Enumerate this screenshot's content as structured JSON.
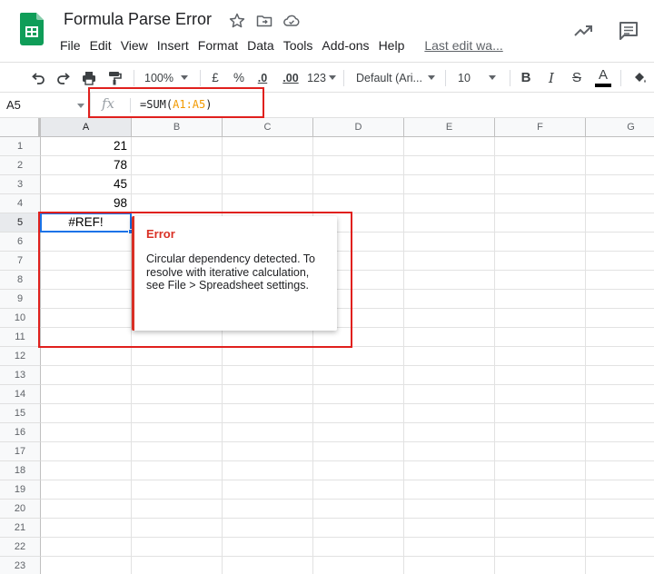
{
  "app": {
    "document_title": "Formula Parse Error",
    "last_edit": "Last edit wa...",
    "brand_color": "#0f9d58"
  },
  "menu": [
    "File",
    "Edit",
    "View",
    "Insert",
    "Format",
    "Data",
    "Tools",
    "Add-ons",
    "Help"
  ],
  "toolbar": {
    "zoom": "100%",
    "currency": "£",
    "percent": "%",
    "decrease_decimal": ".0",
    "increase_decimal": ".00",
    "more_formats": "123",
    "font_family": "Default (Ari...",
    "font_size": "10",
    "bold": "B",
    "italic": "I",
    "strikethrough": "S",
    "text_color": "A"
  },
  "formula_bar": {
    "cell_reference": "A5",
    "fx_label": "fx",
    "formula_prefix": "=SUM(",
    "formula_range": "A1:A5",
    "formula_suffix": ")"
  },
  "sheet": {
    "columns": [
      "A",
      "B",
      "C",
      "D",
      "E",
      "F",
      "G"
    ],
    "rows": [
      "1",
      "2",
      "3",
      "4",
      "5",
      "6",
      "7",
      "8",
      "9",
      "10",
      "11",
      "12",
      "13",
      "14",
      "15",
      "16",
      "17",
      "18",
      "19",
      "20",
      "21",
      "22",
      "23"
    ],
    "cells": {
      "A1": "21",
      "A2": "78",
      "A3": "45",
      "A4": "98",
      "A5": "#REF!"
    },
    "selected_cell": "A5"
  },
  "error_popup": {
    "title": "Error",
    "message": "Circular dependency detected. To resolve with iterative calculation, see File > Spreadsheet settings.",
    "accent_color": "#d93025"
  },
  "annotation_color": "#e0201d",
  "selection_color": "#1a73e8"
}
